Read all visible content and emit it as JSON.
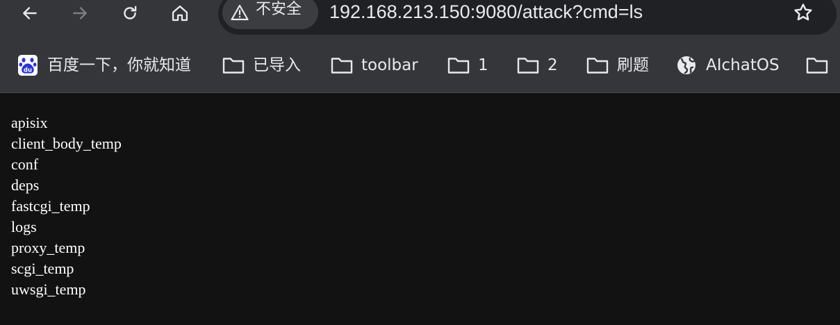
{
  "toolbar": {
    "back_icon": "arrow-left-icon",
    "forward_icon": "arrow-right-icon",
    "reload_icon": "reload-icon",
    "home_icon": "home-icon",
    "security_label": "不安全",
    "security_icon": "warning-triangle-icon",
    "url": "192.168.213.150:9080/attack?cmd=ls",
    "bookmark_star_icon": "star-outline-icon"
  },
  "bookmarks": [
    {
      "label": "百度一下，你就知道",
      "icon": "baidu-paw-icon"
    },
    {
      "label": "已导入",
      "icon": "folder-icon"
    },
    {
      "label": "toolbar",
      "icon": "folder-icon"
    },
    {
      "label": "1",
      "icon": "folder-icon"
    },
    {
      "label": "2",
      "icon": "folder-icon"
    },
    {
      "label": "刷题",
      "icon": "folder-icon"
    },
    {
      "label": "AIchatOS",
      "icon": "globe-icon"
    }
  ],
  "colors": {
    "chrome_bg": "#35363a",
    "omnibox_bg": "#202124",
    "page_bg": "#121212",
    "text": "#e8eaed",
    "baidu_blue": "#2932e1"
  },
  "output_lines": [
    "apisix",
    "client_body_temp",
    "conf",
    "deps",
    "fastcgi_temp",
    "logs",
    "proxy_temp",
    "scgi_temp",
    "uwsgi_temp"
  ]
}
